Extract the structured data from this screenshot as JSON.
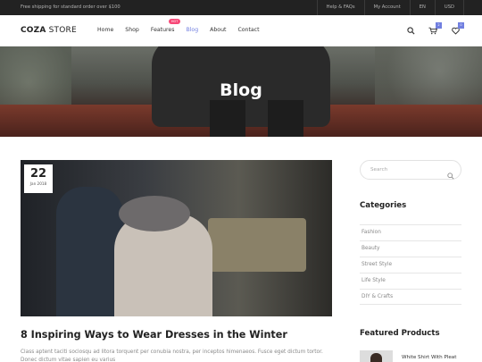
{
  "topbar": {
    "promo": "Free shipping for standard order over $100",
    "links": [
      "Help & FAQs",
      "My Account",
      "EN",
      "USD"
    ]
  },
  "header": {
    "logo_bold": "COZA",
    "logo_light": " STORE",
    "nav": [
      "Home",
      "Shop",
      "Features",
      "Blog",
      "About",
      "Contact"
    ],
    "hot_badge": "HOT",
    "cart_count": "2",
    "wishlist_count": "0",
    "icons": [
      "search-icon",
      "cart-icon",
      "heart-icon"
    ]
  },
  "banner": {
    "title": "Blog"
  },
  "post": {
    "day": "22",
    "month_year": "Jan 2018",
    "title": "8 Inspiring Ways to Wear Dresses in the Winter",
    "excerpt": "Class aptent taciti sociosqu ad litora torquent per conubia nostra, per inceptos himenaeos. Fusce eget dictum tortor. Donec dictum vitae sapien eu varius"
  },
  "sidebar": {
    "search_placeholder": "Search",
    "categories_title": "Categories",
    "categories": [
      "Fashion",
      "Beauty",
      "Street Style",
      "Life Style",
      "DIY & Crafts"
    ],
    "featured_title": "Featured Products",
    "featured_item": "White Shirt With Pleat"
  },
  "colors": {
    "accent": "#717fe0",
    "hot": "#f74877",
    "topbar": "#222222"
  }
}
